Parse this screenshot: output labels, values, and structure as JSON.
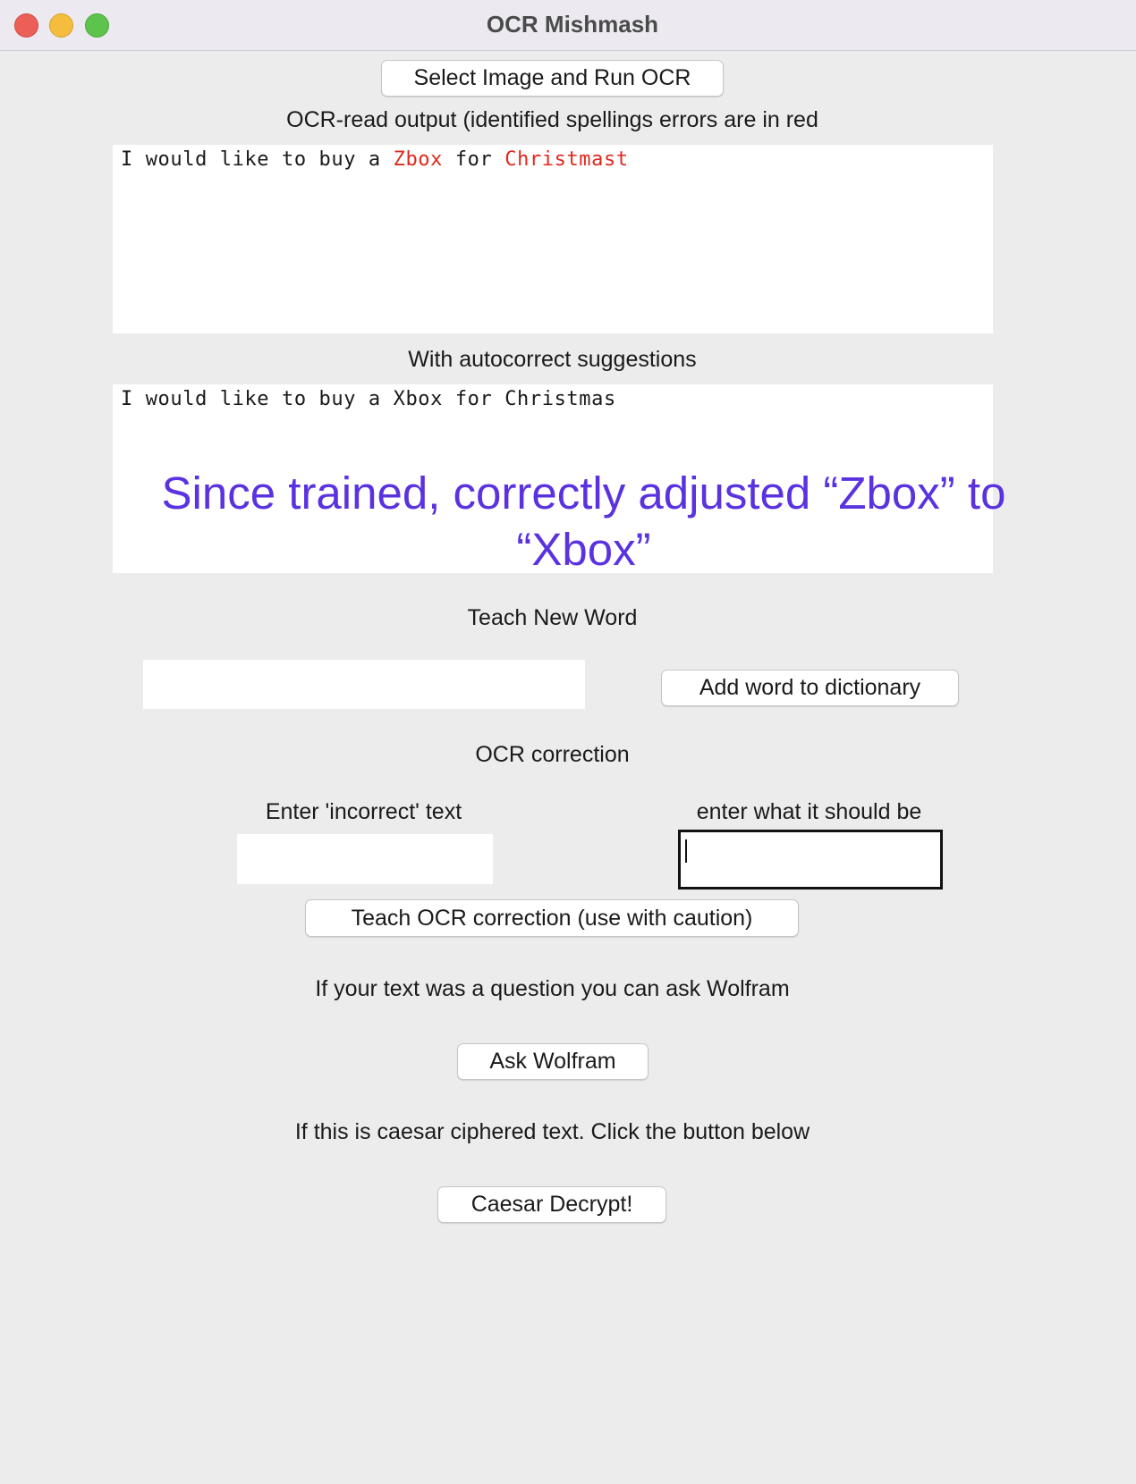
{
  "window": {
    "title": "OCR Mishmash"
  },
  "buttons": {
    "select_image": "Select Image and Run OCR",
    "add_word": "Add word to dictionary",
    "teach_correction": "Teach OCR correction (use with caution)",
    "ask_wolfram": "Ask Wolfram",
    "caesar_decrypt": "Caesar Decrypt!"
  },
  "labels": {
    "ocr_output": "OCR-read output (identified spellings errors are in red",
    "autocorrect": "With autocorrect suggestions",
    "teach_new_word": "Teach New Word",
    "ocr_correction": "OCR correction",
    "incorrect_text": "Enter 'incorrect' text",
    "should_be": "enter what it should be",
    "wolfram_hint": "If your text was a question you can ask Wolfram",
    "caesar_hint": "If this is caesar ciphered text. Click the button below"
  },
  "ocr_output": {
    "segments": [
      {
        "text": "I would like to buy a ",
        "error": false
      },
      {
        "text": "Zbox",
        "error": true
      },
      {
        "text": " for ",
        "error": false
      },
      {
        "text": "Christmast",
        "error": true
      }
    ]
  },
  "autocorrect_output": {
    "text": "I would like to buy a Xbox for Christmas"
  },
  "annotation": {
    "line1": "Since trained, correctly adjusted “Zbox” to",
    "line2": "“Xbox”"
  },
  "inputs": {
    "new_word": "",
    "incorrect_text": "",
    "correct_text": ""
  },
  "colors": {
    "error_text": "#e0281d",
    "annotation": "#5a32e0",
    "window_bg": "#ececec"
  }
}
